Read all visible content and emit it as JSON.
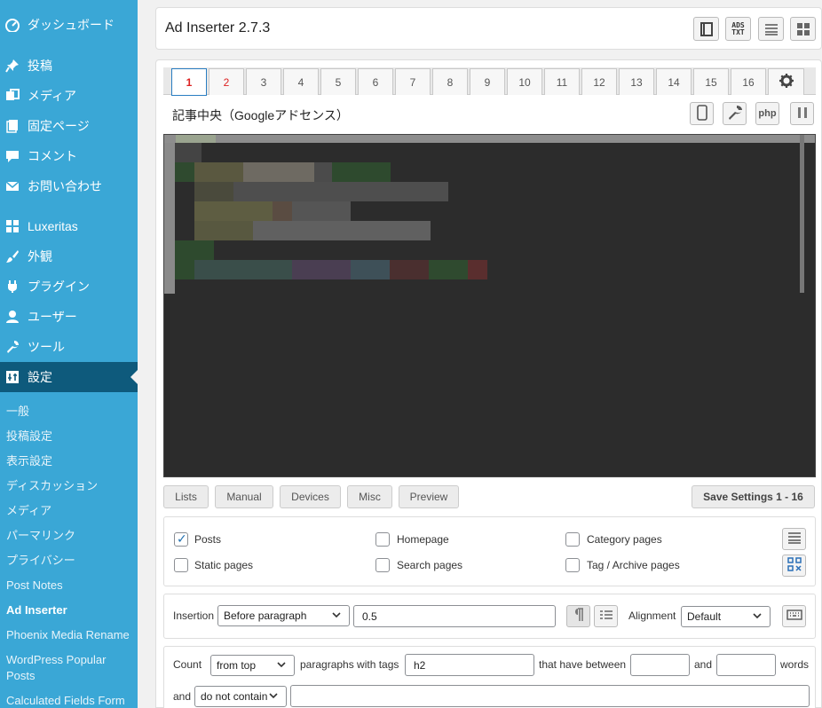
{
  "sidebar": {
    "menu": [
      {
        "label": "ダッシュボード",
        "icon": "dashboard-icon"
      },
      {
        "label": "投稿",
        "icon": "pin-icon"
      },
      {
        "label": "メディア",
        "icon": "media-icon"
      },
      {
        "label": "固定ページ",
        "icon": "page-icon"
      },
      {
        "label": "コメント",
        "icon": "comment-icon"
      },
      {
        "label": "お問い合わせ",
        "icon": "mail-icon"
      },
      {
        "label": "Luxeritas",
        "icon": "grid-icon"
      },
      {
        "label": "外観",
        "icon": "brush-icon"
      },
      {
        "label": "プラグイン",
        "icon": "plugin-icon"
      },
      {
        "label": "ユーザー",
        "icon": "user-icon"
      },
      {
        "label": "ツール",
        "icon": "wrench-icon"
      },
      {
        "label": "設定",
        "icon": "settings-icon"
      }
    ],
    "submenu": [
      "一般",
      "投稿設定",
      "表示設定",
      "ディスカッション",
      "メディア",
      "パーマリンク",
      "プライバシー",
      "Post Notes",
      "Ad Inserter",
      "Phoenix Media Rename",
      "WordPress Popular Posts",
      "Calculated Fields Form"
    ]
  },
  "header": {
    "title": "Ad Inserter 2.7.3",
    "ads_txt_line1": "ADS",
    "ads_txt_line2": "TXT",
    "icons": [
      "book-icon",
      "ads-txt-icon",
      "list-icon",
      "blocks-grid-icon"
    ]
  },
  "tabs": [
    "1",
    "2",
    "3",
    "4",
    "5",
    "6",
    "7",
    "8",
    "9",
    "10",
    "11",
    "12",
    "13",
    "14",
    "15",
    "16"
  ],
  "block": {
    "name": "記事中央（Googleアドセンス）",
    "php_label": "php"
  },
  "section_buttons": {
    "lists": "Lists",
    "manual": "Manual",
    "devices": "Devices",
    "misc": "Misc",
    "preview": "Preview",
    "save": "Save Settings 1 - 16"
  },
  "checkboxes": {
    "posts": {
      "label": "Posts",
      "checked": true
    },
    "static_pages": {
      "label": "Static pages",
      "checked": false
    },
    "homepage": {
      "label": "Homepage",
      "checked": false
    },
    "search_pages": {
      "label": "Search pages",
      "checked": false
    },
    "category_pages": {
      "label": "Category pages",
      "checked": false
    },
    "tag_archive_pages": {
      "label": "Tag / Archive pages",
      "checked": false
    }
  },
  "insertion": {
    "label": "Insertion",
    "value": "Before paragraph",
    "position": "0.5",
    "alignment_label": "Alignment",
    "alignment_value": "Default"
  },
  "count": {
    "label": "Count",
    "direction": "from top",
    "text1": "paragraphs with tags",
    "tags": "h2",
    "text2": "that have between",
    "min": "",
    "and_label": "and",
    "max": "",
    "words_label": "words",
    "and2_label": "and",
    "contain_mode": "do not contain",
    "contain_value": ""
  },
  "colors": {
    "sidebar_bg": "#3aa7d6",
    "sidebar_active": "#0e5a7c",
    "tab_active_text": "#dd2222",
    "editor_bg": "#2c2c2c"
  }
}
